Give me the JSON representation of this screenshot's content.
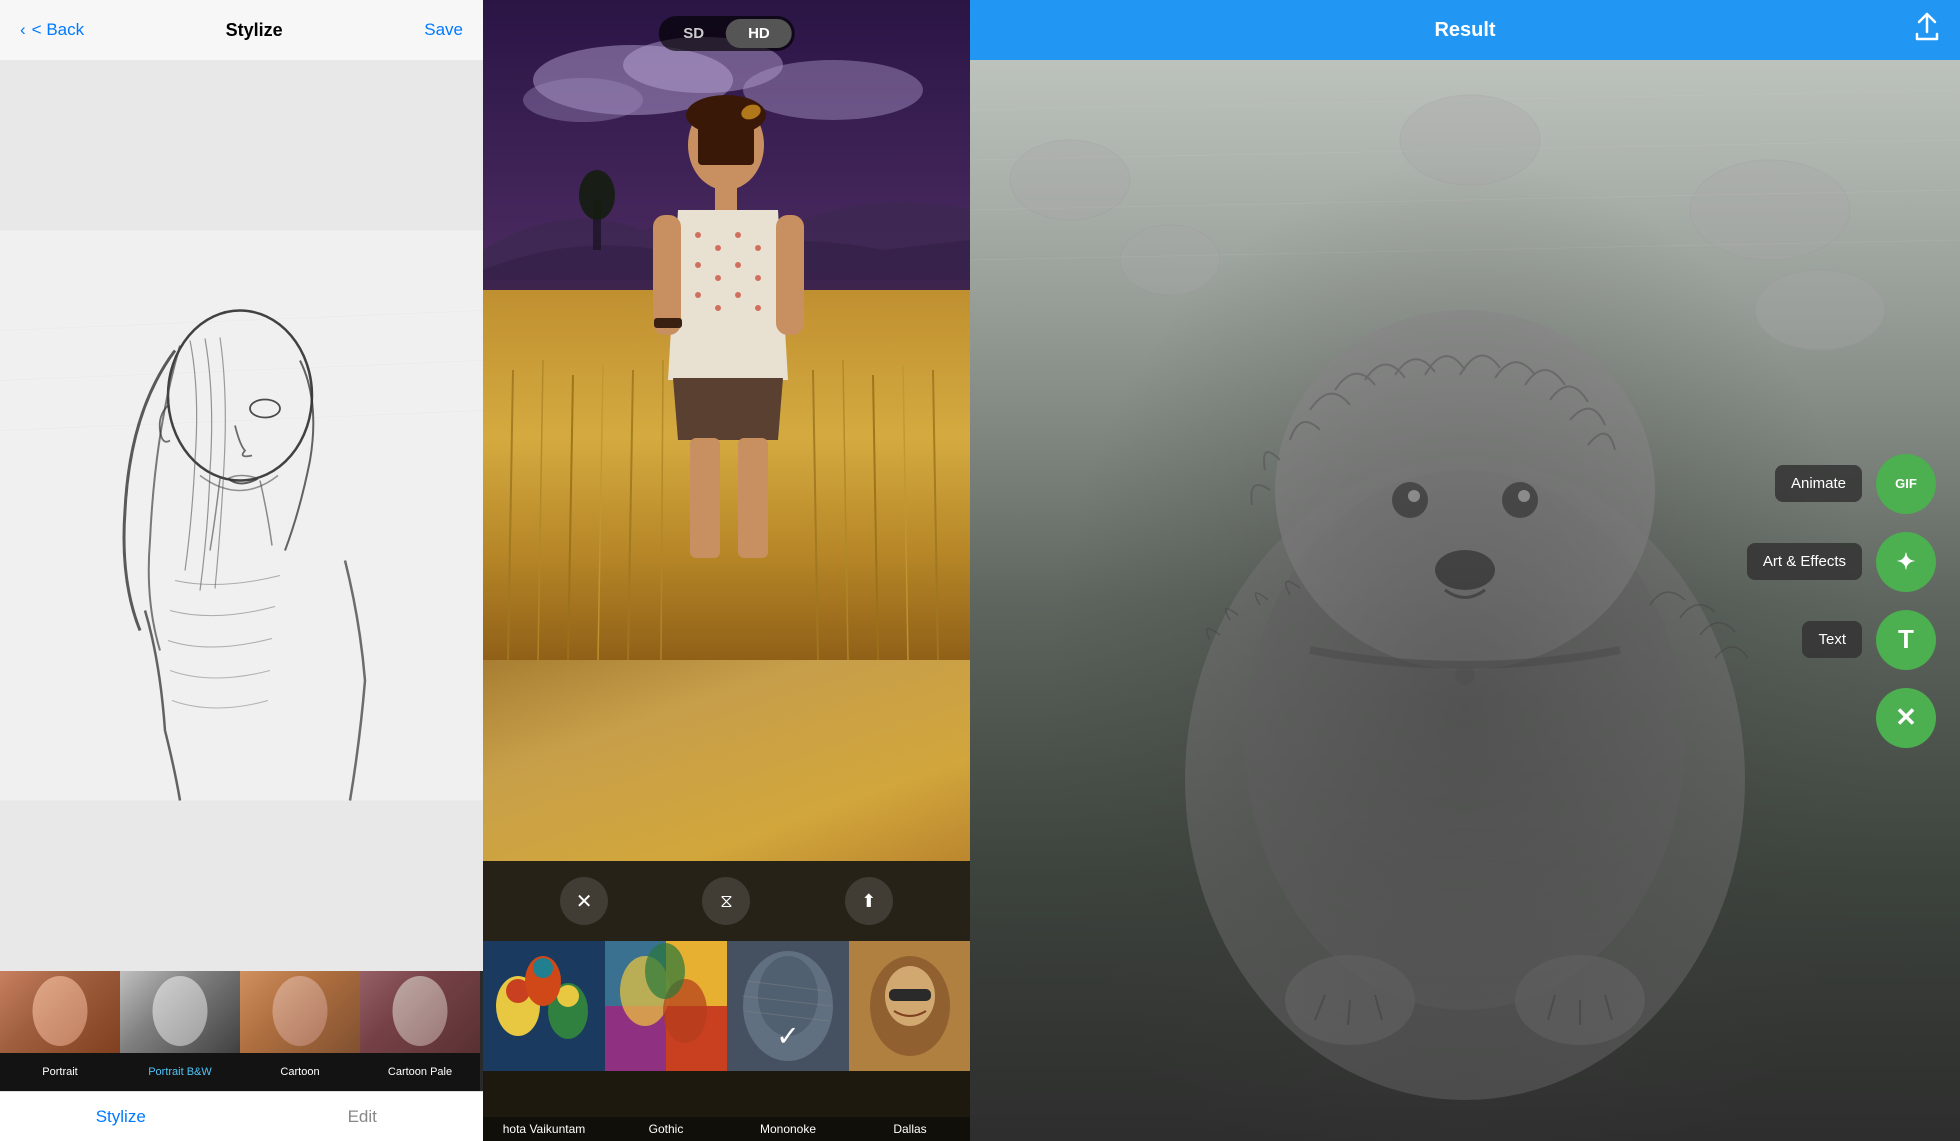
{
  "panel1": {
    "header": {
      "back_label": "< Back",
      "title": "Stylize",
      "save_label": "Save"
    },
    "filters": [
      {
        "id": "portrait",
        "label": "Portrait",
        "selected": false,
        "style": "portrait"
      },
      {
        "id": "portrait-bw",
        "label": "Portrait B&W",
        "selected": true,
        "style": "bw"
      },
      {
        "id": "cartoon",
        "label": "Cartoon",
        "selected": false,
        "style": "cartoon"
      },
      {
        "id": "cartoon-pale",
        "label": "Cartoon Pale",
        "selected": false,
        "style": "pale"
      }
    ],
    "tabs": [
      {
        "id": "stylize",
        "label": "Stylize",
        "active": true
      },
      {
        "id": "edit",
        "label": "Edit",
        "active": false
      }
    ]
  },
  "panel2": {
    "quality": {
      "options": [
        "SD",
        "HD"
      ],
      "active": "HD"
    },
    "controls": [
      {
        "id": "close",
        "icon": "✕"
      },
      {
        "id": "adjust",
        "icon": "⧖"
      },
      {
        "id": "share",
        "icon": "↑"
      }
    ],
    "styles": [
      {
        "id": "vaikuntam",
        "label": "hota Vaikuntam",
        "bg_class": "bg-vaikuntam",
        "selected": false
      },
      {
        "id": "gothic",
        "label": "Gothic",
        "bg_class": "bg-gothic",
        "selected": false
      },
      {
        "id": "mononoke",
        "label": "Mononoke",
        "bg_class": "bg-mononoke",
        "selected": true
      },
      {
        "id": "dallas",
        "label": "Dallas",
        "bg_class": "bg-dallas",
        "selected": false
      }
    ]
  },
  "panel3": {
    "header": {
      "title": "Result",
      "share_icon": "⬆"
    },
    "action_buttons": [
      {
        "id": "animate",
        "label": "Animate",
        "icon": "GIF"
      },
      {
        "id": "art-effects",
        "label": "Art & Effects",
        "icon": "✦"
      },
      {
        "id": "text",
        "label": "Text",
        "icon": "T"
      },
      {
        "id": "close",
        "label": "",
        "icon": "✕"
      }
    ]
  }
}
